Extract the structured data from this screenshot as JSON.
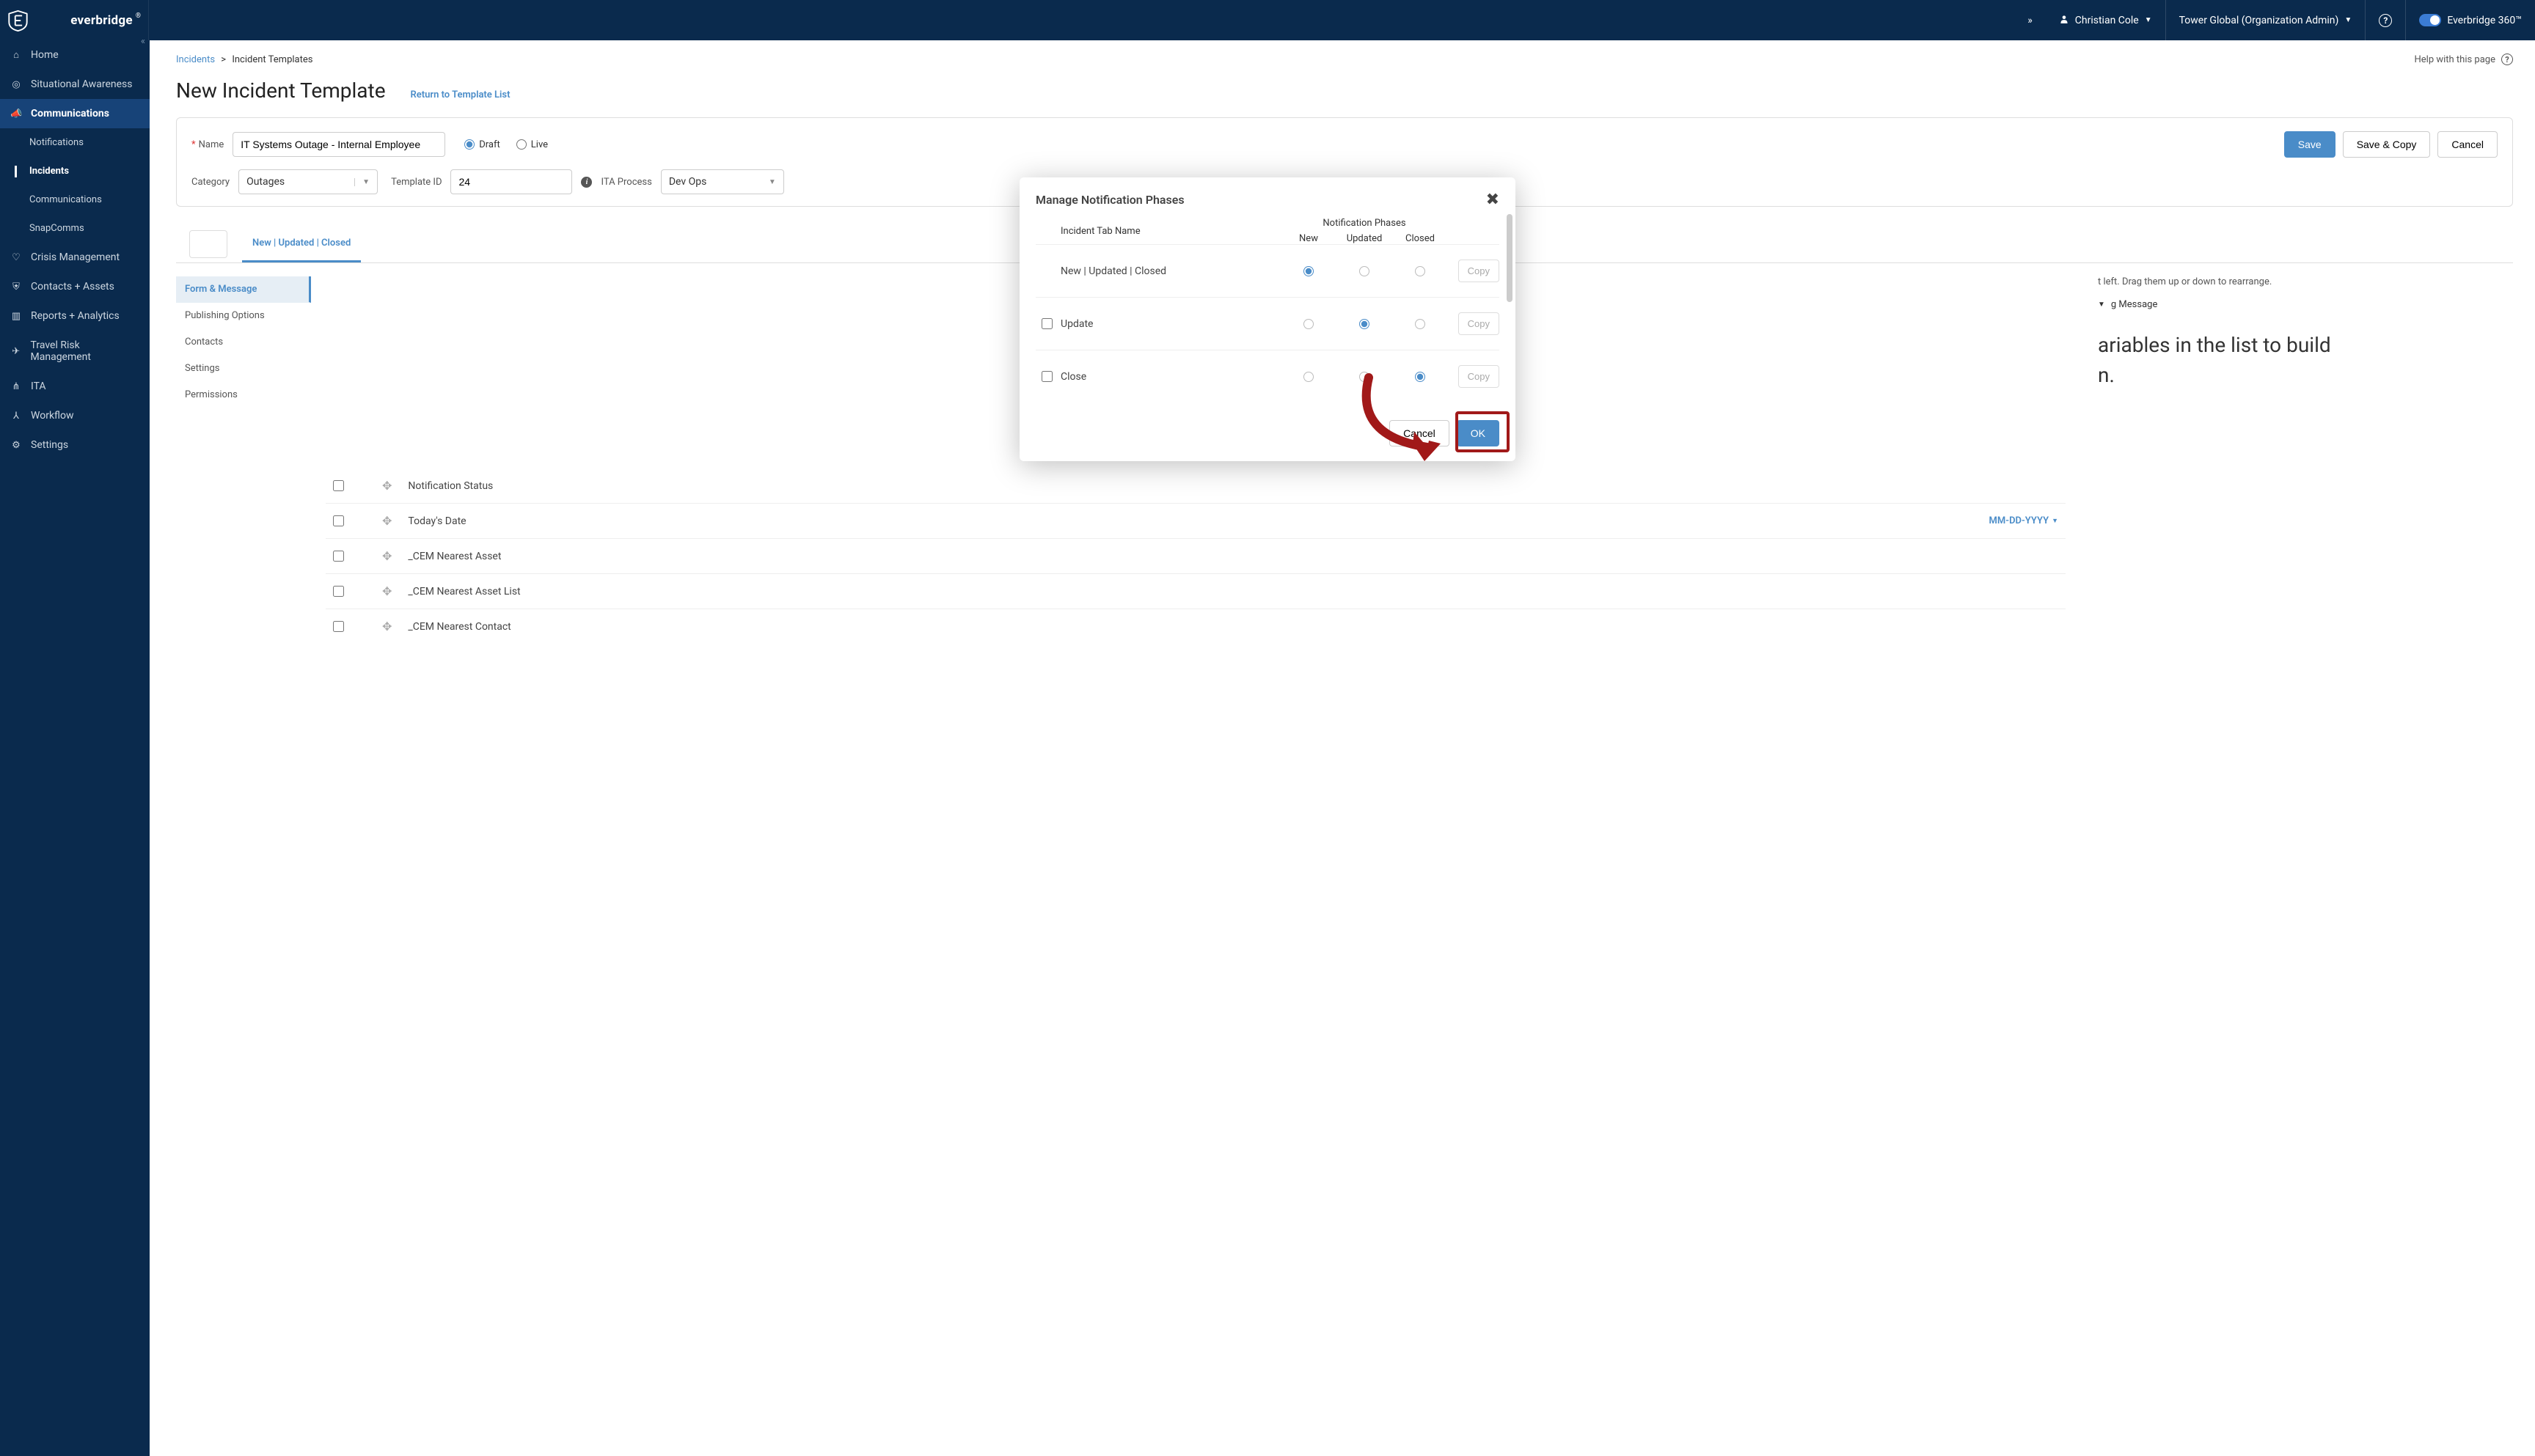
{
  "brand": {
    "name": "everbridge",
    "suite": "Everbridge 360™"
  },
  "topbar": {
    "user": "Christian Cole",
    "org": "Tower Global (Organization Admin)"
  },
  "sidebar": {
    "items": [
      {
        "icon": "home-icon",
        "label": "Home"
      },
      {
        "icon": "target-icon",
        "label": "Situational Awareness"
      },
      {
        "icon": "megaphone-icon",
        "label": "Communications",
        "active": true
      },
      {
        "icon": "",
        "label": "Notifications",
        "sub": true
      },
      {
        "icon": "",
        "label": "Incidents",
        "sub": true,
        "activeSub": true
      },
      {
        "icon": "",
        "label": "Communications",
        "sub": true
      },
      {
        "icon": "",
        "label": "SnapComms",
        "sub": true
      },
      {
        "icon": "heart-icon",
        "label": "Crisis Management"
      },
      {
        "icon": "shield-icon",
        "label": "Contacts + Assets"
      },
      {
        "icon": "barchart-icon",
        "label": "Reports + Analytics"
      },
      {
        "icon": "plane-icon",
        "label": "Travel Risk Management"
      },
      {
        "icon": "nodes-icon",
        "label": "ITA"
      },
      {
        "icon": "flow-icon",
        "label": "Workflow"
      },
      {
        "icon": "gear-icon",
        "label": "Settings"
      }
    ]
  },
  "breadcrumb": {
    "root": "Incidents",
    "leaf": "Incident Templates",
    "help": "Help with this page"
  },
  "page": {
    "title": "New Incident Template",
    "return": "Return to Template List"
  },
  "form": {
    "name_label": "Name",
    "name_value": "IT Systems Outage - Internal Employee",
    "draft": "Draft",
    "live": "Live",
    "save": "Save",
    "save_copy": "Save & Copy",
    "cancel": "Cancel",
    "category_label": "Category",
    "category_value": "Outages",
    "template_id_label": "Template ID",
    "template_id_value": "24",
    "ita_label": "ITA Process",
    "ita_value": "Dev Ops"
  },
  "tabs": {
    "main": "New | Updated | Closed"
  },
  "left_tabs": [
    "Form & Message",
    "Publishing Options",
    "Contacts",
    "Settings",
    "Permissions"
  ],
  "variables": [
    {
      "label": "Notification Status"
    },
    {
      "label": "Today's Date",
      "extra": "MM-DD-YYYY"
    },
    {
      "label": "_CEM Nearest Asset"
    },
    {
      "label": "_CEM Nearest Asset List"
    },
    {
      "label": "_CEM Nearest Contact"
    }
  ],
  "right": {
    "hint_suffix": "hem up or down to rearrange.",
    "hint_prefix_cut": "t left. Drag t",
    "msg_label_suffix": "g Message",
    "big_line1": "ariables in the list to build",
    "big_line2": "n."
  },
  "modal": {
    "title": "Manage Notification Phases",
    "super": "Notification Phases",
    "col_tab": "Incident Tab Name",
    "col_new": "New",
    "col_updated": "Updated",
    "col_closed": "Closed",
    "rows": [
      {
        "name": "New | Updated | Closed",
        "phase": "new",
        "locked": true
      },
      {
        "name": "Update",
        "phase": "updated",
        "locked": false
      },
      {
        "name": "Close",
        "phase": "closed",
        "locked": false
      }
    ],
    "copy": "Copy",
    "cancel": "Cancel",
    "ok": "OK"
  }
}
